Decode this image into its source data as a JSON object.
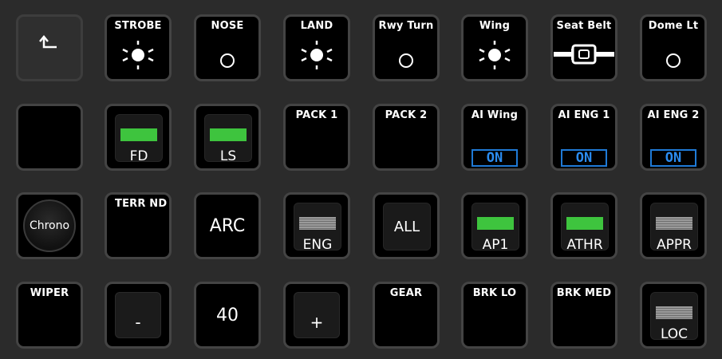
{
  "row1": {
    "back": {
      "icon": "back-arrow-icon",
      "glyph": "↰"
    },
    "strobe": {
      "label": "STROBE",
      "icon": "light-on-icon"
    },
    "nose": {
      "label": "NOSE",
      "icon": "light-off-icon"
    },
    "land": {
      "label": "LAND",
      "icon": "light-on-icon"
    },
    "rwy_turn": {
      "label": "Rwy Turn",
      "icon": "light-off-icon"
    },
    "wing": {
      "label": "Wing",
      "icon": "light-on-icon"
    },
    "seat_belt": {
      "label": "Seat Belt",
      "icon": "seat-belt-icon"
    },
    "dome_lt": {
      "label": "Dome Lt",
      "icon": "light-off-icon"
    }
  },
  "row2": {
    "fd": {
      "label": "FD",
      "indicator": "green"
    },
    "ls": {
      "label": "LS",
      "indicator": "green"
    },
    "pack1": {
      "label": "PACK 1"
    },
    "pack2": {
      "label": "PACK 2"
    },
    "ai_wing": {
      "label": "AI Wing",
      "status": "ON"
    },
    "ai_eng1": {
      "label": "AI ENG 1",
      "status": "ON"
    },
    "ai_eng2": {
      "label": "AI ENG 2",
      "status": "ON"
    }
  },
  "row3": {
    "chrono": {
      "label": "Chrono"
    },
    "terr_nd": {
      "label": "TERR ND"
    },
    "arc": {
      "label": "ARC"
    },
    "eng": {
      "label": "ENG",
      "indicator": "gray"
    },
    "all": {
      "label": "ALL"
    },
    "ap1": {
      "label": "AP1",
      "indicator": "green"
    },
    "athr": {
      "label": "ATHR",
      "indicator": "green"
    },
    "appr": {
      "label": "APPR",
      "indicator": "gray"
    }
  },
  "row4": {
    "wiper": {
      "label": "WIPER"
    },
    "minus": {
      "label": "-"
    },
    "value": {
      "label": "40"
    },
    "plus": {
      "label": "+"
    },
    "gear": {
      "label": "GEAR"
    },
    "brk_lo": {
      "label": "BRK LO"
    },
    "brk_med": {
      "label": "BRK MED"
    },
    "loc": {
      "label": "LOC",
      "indicator": "gray"
    }
  },
  "colors": {
    "background": "#2b2b2b",
    "on_green": "#3ec43e",
    "status_blue": "#1f7ad6",
    "off_gray": "#8a8a8a"
  }
}
